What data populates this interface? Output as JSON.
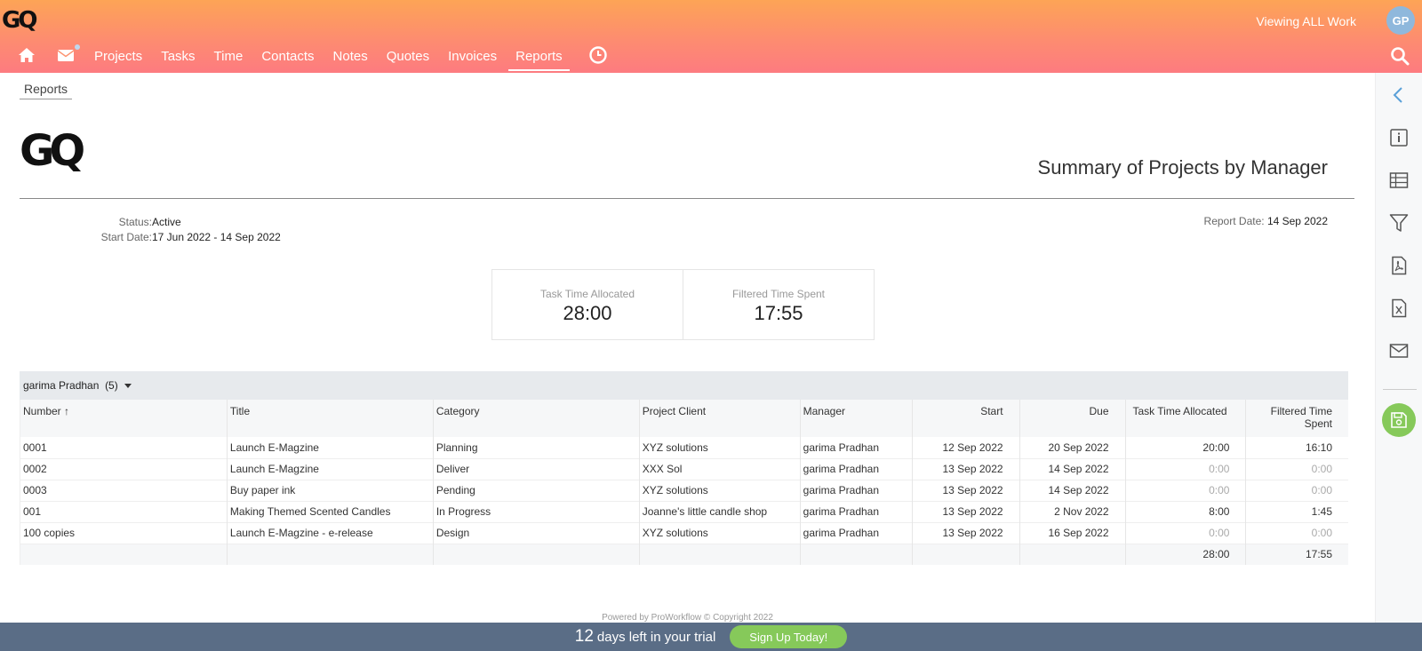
{
  "app": {
    "logo": "GQ",
    "viewing": "Viewing ALL Work",
    "avatar": "GP"
  },
  "nav": {
    "items": [
      {
        "label": "Projects"
      },
      {
        "label": "Tasks"
      },
      {
        "label": "Time"
      },
      {
        "label": "Contacts"
      },
      {
        "label": "Notes"
      },
      {
        "label": "Quotes"
      },
      {
        "label": "Invoices"
      },
      {
        "label": "Reports",
        "active": true
      }
    ],
    "icons": [
      "home-icon",
      "mail-icon",
      "clock-icon",
      "search-icon"
    ]
  },
  "breadcrumb": "Reports",
  "report": {
    "logo": "GQ",
    "title": "Summary of Projects by Manager",
    "status_label": "Status:",
    "status_value": "Active",
    "start_label": "Start Date:",
    "start_value": "17 Jun 2022 - 14 Sep 2022",
    "report_date_label": "Report Date:",
    "report_date_value": "14 Sep 2022"
  },
  "cards": [
    {
      "label": "Task Time Allocated",
      "value": "28:00"
    },
    {
      "label": "Filtered Time Spent",
      "value": "17:55"
    }
  ],
  "group": {
    "name": "garima Pradhan",
    "count": "(5)"
  },
  "table": {
    "headers": [
      "Number",
      "Title",
      "Category",
      "Project Client",
      "Manager",
      "Start",
      "Due",
      "Task Time Allocated",
      "Filtered Time Spent"
    ],
    "sort_icon": "arrow-up-icon",
    "rows": [
      [
        "0001",
        "Launch E-Magzine",
        "Planning",
        "XYZ solutions",
        "garima Pradhan",
        "12 Sep 2022",
        "20 Sep 2022",
        "20:00",
        "16:10"
      ],
      [
        "0002",
        "Launch E-Magzine",
        "Deliver",
        "XXX Sol",
        "garima Pradhan",
        "13 Sep 2022",
        "14 Sep 2022",
        "0:00",
        "0:00"
      ],
      [
        "0003",
        "Buy paper ink",
        "Pending",
        "XYZ solutions",
        "garima Pradhan",
        "13 Sep 2022",
        "14 Sep 2022",
        "0:00",
        "0:00"
      ],
      [
        "001",
        "Making Themed Scented Candles",
        "In Progress",
        "Joanne's little candle shop",
        "garima Pradhan",
        "13 Sep 2022",
        "2 Nov 2022",
        "8:00",
        "1:45"
      ],
      [
        "100 copies",
        "Launch E-Magzine - e-release",
        "Design",
        "XYZ solutions",
        "garima Pradhan",
        "13 Sep 2022",
        "16 Sep 2022",
        "0:00",
        "0:00"
      ]
    ],
    "totals": [
      "28:00",
      "17:55"
    ]
  },
  "footer": "Powered by ProWorkflow © Copyright 2022",
  "trial": {
    "days": "12",
    "text": "days left in your trial",
    "button": "Sign Up Today!"
  },
  "sidebar_icons": [
    "chevron-left-icon",
    "info-icon",
    "table-icon",
    "filter-icon",
    "pdf-icon",
    "excel-icon",
    "email-icon",
    "save-icon"
  ],
  "colors": {
    "header_start": "#fda456",
    "header_end": "#fd7b80",
    "trial_bar": "#5a6d86",
    "accent_green": "#86c95a"
  }
}
